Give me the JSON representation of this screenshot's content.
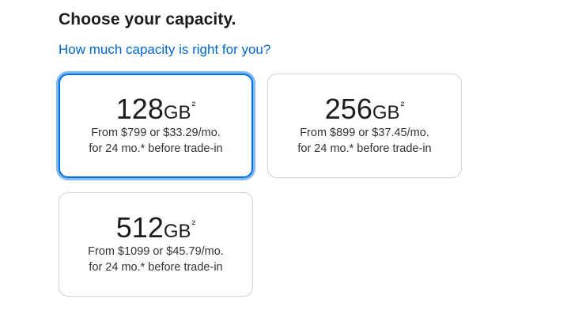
{
  "heading": "Choose your capacity.",
  "help_link": "How much capacity is right for you?",
  "colors": {
    "link": "#0066cc",
    "selected_border": "#0071e3",
    "card_border": "#d2d2d7",
    "text": "#1d1d1f"
  },
  "options": [
    {
      "size": "128",
      "unit": "GB",
      "footnote": "²",
      "price_line1": "From $799 or $33.29/mo.",
      "price_line2": "for 24 mo.* before trade-in",
      "selected": true
    },
    {
      "size": "256",
      "unit": "GB",
      "footnote": "²",
      "price_line1": "From $899 or $37.45/mo.",
      "price_line2": "for 24 mo.* before trade-in",
      "selected": false
    },
    {
      "size": "512",
      "unit": "GB",
      "footnote": "²",
      "price_line1": "From $1099 or $45.79/mo.",
      "price_line2": "for 24 mo.* before trade-in",
      "selected": false
    }
  ]
}
